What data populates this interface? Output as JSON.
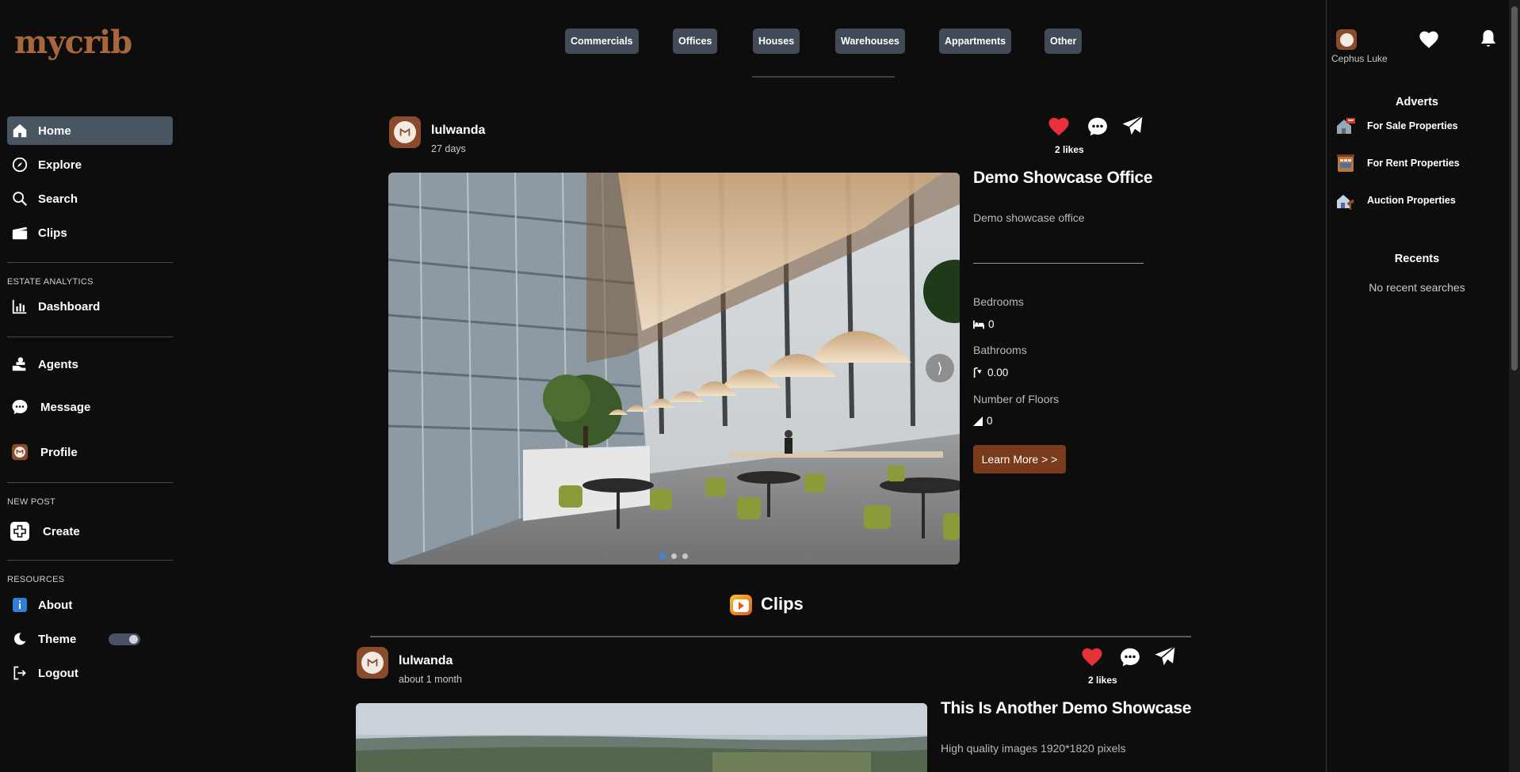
{
  "brand": {
    "logo": "mycrib",
    "color": "#a8663d"
  },
  "sidebar": {
    "items": [
      {
        "label": "Home",
        "icon": "home-icon"
      },
      {
        "label": "Explore",
        "icon": "compass-icon"
      },
      {
        "label": "Search",
        "icon": "search-icon"
      },
      {
        "label": "Clips",
        "icon": "clapperboard-icon"
      }
    ],
    "analytics_heading": "ESTATE ANALYTICS",
    "dashboard": "Dashboard",
    "agents": "Agents",
    "message": "Message",
    "profile": "Profile",
    "new_post_heading": "NEW POST",
    "create": "Create",
    "resources_heading": "RESOURCES",
    "about": "About",
    "theme": "Theme",
    "logout": "Logout"
  },
  "categories": [
    "Commercials",
    "Offices",
    "Houses",
    "Warehouses",
    "Appartments",
    "Other"
  ],
  "posts": [
    {
      "user": "lulwanda",
      "time": "27 days",
      "likes": "2 likes",
      "title": "Demo Showcase Office",
      "description": "Demo showcase office",
      "specs": {
        "bedrooms_label": "Bedrooms",
        "bedrooms": "0",
        "bathrooms_label": "Bathrooms",
        "bathrooms": "0.00",
        "floors_label": "Number of Floors",
        "floors": "0"
      },
      "learn_more": "Learn More > >",
      "slides": 3,
      "active_slide": 1
    },
    {
      "user": "lulwanda",
      "time": "about 1 month",
      "likes": "2 likes",
      "title": "This Is Another Demo Showcase",
      "description": "High quality images 1920*1820 pixels"
    }
  ],
  "clips": {
    "label": "Clips"
  },
  "right": {
    "username": "Cephus Luke",
    "adverts_heading": "Adverts",
    "adverts": [
      "For Sale Properties",
      "For Rent Properties",
      "Auction Properties"
    ],
    "recents_heading": "Recents",
    "recents_empty": "No recent searches"
  },
  "colors": {
    "like": "#e8303a",
    "accent_button": "#7a3a1c",
    "nav_active": "#4a5562"
  }
}
